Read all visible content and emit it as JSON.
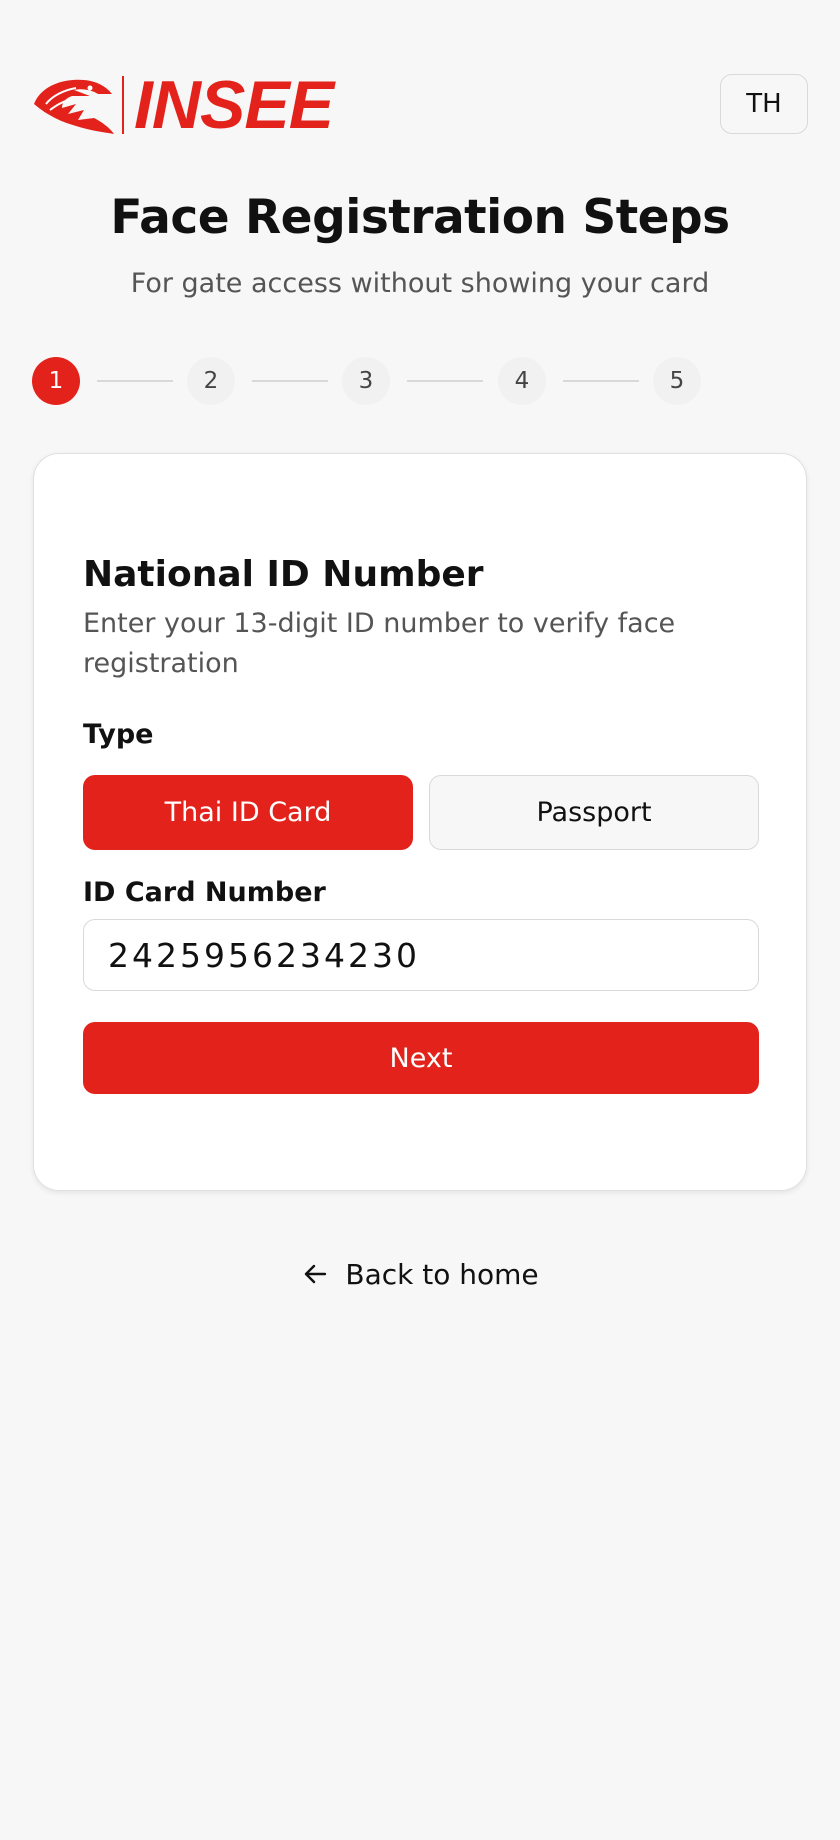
{
  "brand": {
    "name": "INSEE",
    "color": "#e3231b",
    "logo_icon": "eagle-head-icon"
  },
  "header": {
    "language_button": "TH"
  },
  "page": {
    "title": "Face Registration Steps",
    "subtitle": "For gate access without showing your card"
  },
  "stepper": {
    "current_step": 1,
    "steps": [
      "1",
      "2",
      "3",
      "4",
      "5"
    ]
  },
  "form": {
    "section_title": "National ID Number",
    "section_description": "Enter your 13-digit ID number to verify face registration",
    "type_label": "Type",
    "type_options": [
      "Thai ID Card",
      "Passport"
    ],
    "selected_type": "Thai ID Card",
    "id_label": "ID Card Number",
    "id_value": "2425956234230",
    "next_button": "Next"
  },
  "footer": {
    "back_link": "Back to home",
    "back_icon": "arrow-left-icon"
  }
}
